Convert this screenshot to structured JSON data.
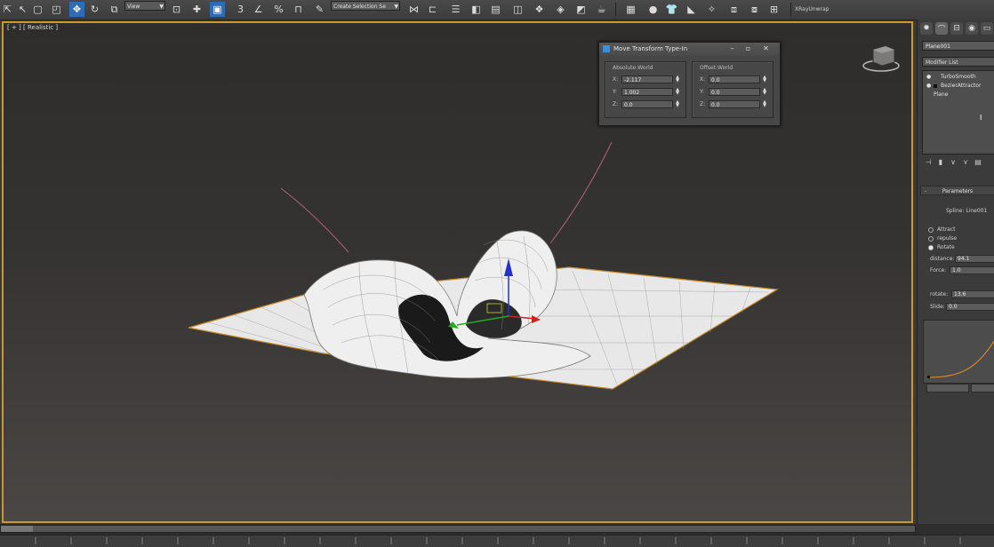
{
  "toolbar": {
    "view_dropdown": "View",
    "selection_set_dropdown": "Create Selection Se",
    "xray_label": "XRayUnwrap",
    "icons": [
      "select-link-icon",
      "select-object-icon",
      "select-region-icon",
      "window-crossing-icon",
      "move-icon",
      "rotate-icon",
      "scale-icon",
      "reference-coordinate-icon",
      "pivot-icon",
      "select-manipulate-icon",
      "snap-icon",
      "angle-snap-icon",
      "percent-snap-icon",
      "spinner-snap-icon",
      "edit-named-selection-icon",
      "mirror-icon",
      "align-icon",
      "layer-manager-icon",
      "graphite-ribbon-icon",
      "curve-editor-icon",
      "schematic-view-icon",
      "material-editor-icon",
      "render-setup-icon",
      "render-frame-icon",
      "render-icon"
    ],
    "colors": {
      "active_tool": "#2f6cb8"
    }
  },
  "viewport": {
    "label": "[ + ] [ Realistic ]",
    "border_color": "#c79a2a"
  },
  "dialog": {
    "title": "Move Transform Type-In",
    "absolute": {
      "title": "Absolute:World",
      "x_label": "X:",
      "x": "-2.117",
      "y_label": "Y:",
      "y": "1.002",
      "z_label": "Z:",
      "z": "0.0"
    },
    "offset": {
      "title": "Offset:World",
      "x_label": "X:",
      "x": "0.0",
      "y_label": "Y:",
      "y": "0.0",
      "z_label": "Z:",
      "z": "0.0"
    }
  },
  "command_panel": {
    "object_name": "Plane001",
    "modifier_list": "Modifier List",
    "stack": [
      "TurboSmooth",
      "BezierAttractor",
      "Plane"
    ],
    "parameters_title": "Parameters",
    "spline_label": "Spline: Line001",
    "radios": [
      {
        "label": "Attract",
        "selected": false
      },
      {
        "label": "repulse",
        "selected": false
      },
      {
        "label": "Rotate",
        "selected": true
      }
    ],
    "params": [
      {
        "label": "distance:",
        "value": "94.1"
      },
      {
        "label": "Force:",
        "value": "1.0"
      },
      {
        "label": "rotate:",
        "value": "13.6"
      },
      {
        "label": "Slide:",
        "value": "0.0"
      }
    ]
  }
}
